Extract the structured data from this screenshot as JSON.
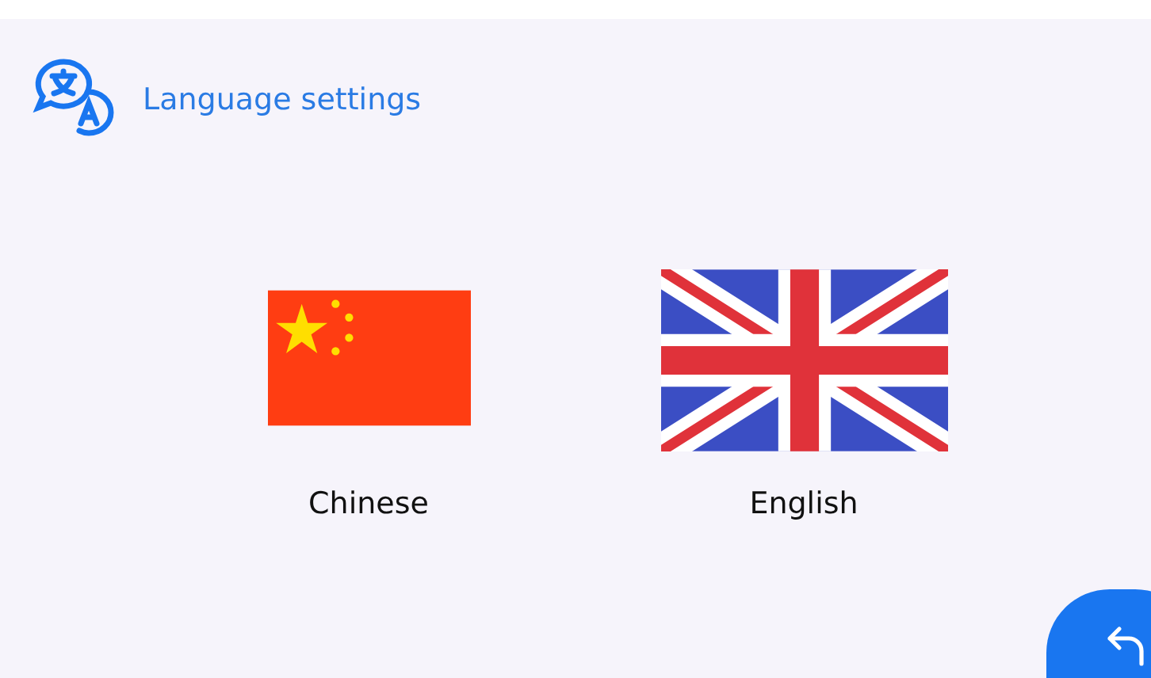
{
  "header": {
    "title": "Language settings"
  },
  "languages": [
    {
      "label": "Chinese",
      "kind": "cn"
    },
    {
      "label": "English",
      "kind": "gb"
    }
  ]
}
